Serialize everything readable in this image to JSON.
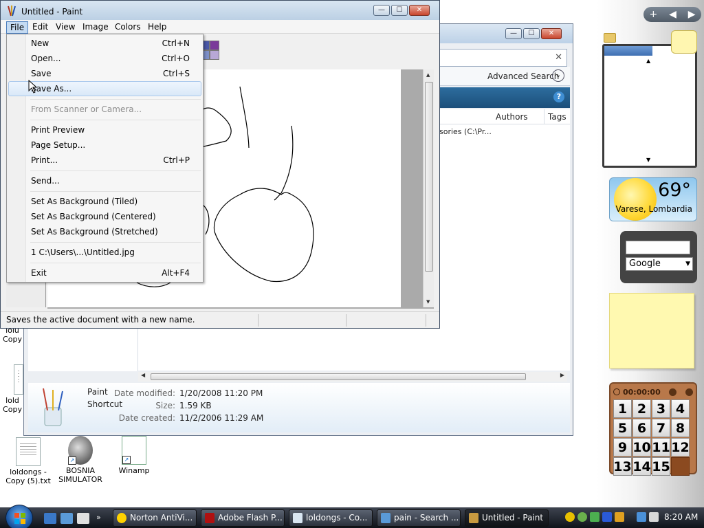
{
  "paint": {
    "title": "Untitled - Paint",
    "menu": [
      "File",
      "Edit",
      "View",
      "Image",
      "Colors",
      "Help"
    ],
    "status": "Saves the active document with a new name."
  },
  "file_menu": {
    "items": [
      {
        "label": "New",
        "shortcut": "Ctrl+N"
      },
      {
        "label": "Open...",
        "shortcut": "Ctrl+O"
      },
      {
        "label": "Save",
        "shortcut": "Ctrl+S"
      },
      {
        "label": "Save As...",
        "shortcut": ""
      },
      {
        "label": "From Scanner or Camera...",
        "shortcut": ""
      },
      {
        "label": "Print Preview",
        "shortcut": ""
      },
      {
        "label": "Page Setup...",
        "shortcut": ""
      },
      {
        "label": "Print...",
        "shortcut": "Ctrl+P"
      },
      {
        "label": "Send...",
        "shortcut": ""
      },
      {
        "label": "Set As Background (Tiled)",
        "shortcut": ""
      },
      {
        "label": "Set As Background (Centered)",
        "shortcut": ""
      },
      {
        "label": "Set As Background (Stretched)",
        "shortcut": ""
      },
      {
        "label": "1 C:\\Users\\...\\Untitled.jpg",
        "shortcut": ""
      },
      {
        "label": "Exit",
        "shortcut": "Alt+F4"
      }
    ],
    "highlighted": "Save As...",
    "disabled": [
      "From Scanner or Camera..."
    ]
  },
  "explorer": {
    "advanced_search": "Advanced Search",
    "columns": [
      "Authors",
      "Tags"
    ],
    "row_partial": "sories (C:\\Pr...",
    "details": {
      "name": "Paint",
      "type": "Shortcut",
      "date_modified_label": "Date modified:",
      "date_modified": "1/20/2008 11:20 PM",
      "size_label": "Size:",
      "size": "1.59 KB",
      "date_created_label": "Date created:",
      "date_created": "11/2/2006 11:29 AM"
    }
  },
  "desktop_icons": [
    {
      "label_line1": "loldongs -",
      "label_line2": "Copy (5).txt"
    },
    {
      "label_line1": "BOSNIA",
      "label_line2": "SIMULATOR"
    },
    {
      "label_line1": "Winamp",
      "label_line2": ""
    }
  ],
  "desktop_partial_labels": [
    "lolu",
    "Copy",
    "lold",
    "Copy"
  ],
  "weather": {
    "temp": "69°",
    "location": "Varese, Lombardia"
  },
  "search_gadget": {
    "engine": "Google"
  },
  "puzzle": {
    "time": "00:00:00",
    "tiles": [
      "1",
      "2",
      "3",
      "4",
      "5",
      "6",
      "7",
      "8",
      "9",
      "10",
      "11",
      "12",
      "13",
      "14",
      "15",
      ""
    ]
  },
  "taskbar": {
    "buttons": [
      "Norton AntiVi...",
      "Adobe Flash P...",
      "loldongs - Co...",
      "pain - Search ...",
      "Untitled - Paint"
    ],
    "active": "Untitled - Paint",
    "clock": "8:20 AM"
  },
  "colors": {
    "accent": "#1d5aa8",
    "highlight": "#d9e8f8",
    "titlebar": "#bcd1e7"
  }
}
